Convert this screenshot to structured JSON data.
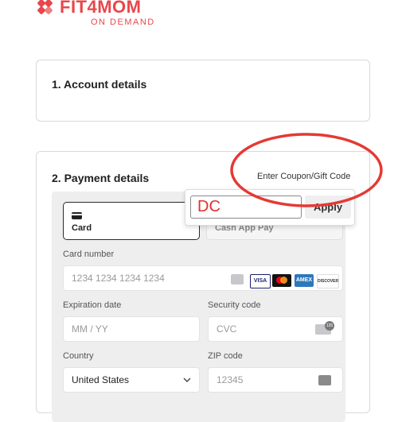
{
  "brand": {
    "name": "FIT4MOM",
    "sub": "ON DEMAND",
    "color": "#e8474b"
  },
  "account": {
    "title": "1. Account details"
  },
  "payment": {
    "title": "2. Payment details",
    "coupon_link": "Enter Coupon/Gift Code",
    "tabs": [
      {
        "label": "Card",
        "icon": "credit-card-icon",
        "selected": true
      },
      {
        "label": "Cash App Pay",
        "selected": false
      }
    ],
    "card_number": {
      "label": "Card number",
      "placeholder": "1234 1234 1234 1234"
    },
    "card_brands": [
      "VISA",
      "Mastercard",
      "AMEX",
      "DISCOVER"
    ],
    "expiration": {
      "label": "Expiration date",
      "placeholder": "MM / YY"
    },
    "security": {
      "label": "Security code",
      "placeholder": "CVC",
      "badge": "135"
    },
    "country": {
      "label": "Country",
      "value": "United States"
    },
    "zip": {
      "label": "ZIP code",
      "placeholder": "12345"
    }
  },
  "coupon": {
    "value": "DC",
    "apply_label": "Apply"
  },
  "annotation_color": "#e53935"
}
